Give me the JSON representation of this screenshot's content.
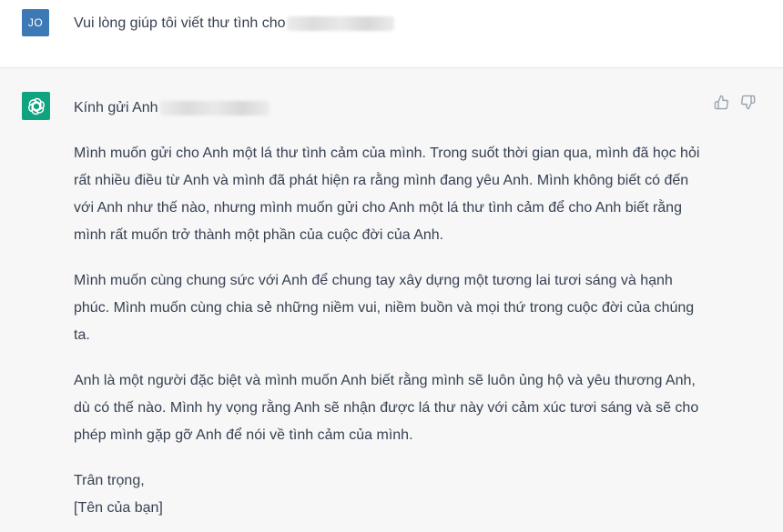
{
  "user": {
    "avatar_initials": "JO",
    "avatar_color": "#3d7ab5",
    "message": "Vui lòng giúp tôi viết thư tình cho"
  },
  "assistant": {
    "avatar_icon": "openai-logo-icon",
    "avatar_color": "#10a37f",
    "greeting": "Kính gửi Anh",
    "paragraphs": [
      "Mình muốn gửi cho Anh một lá thư tình cảm của mình. Trong suốt thời gian qua, mình đã học hỏi rất nhiều điều từ Anh và mình đã phát hiện ra rằng mình đang yêu Anh. Mình không biết có đến với Anh như thế nào, nhưng mình muốn gửi cho Anh một lá thư tình cảm để cho Anh biết rằng mình rất muốn trở thành một phần của cuộc đời của Anh.",
      "Mình muốn cùng chung sức với Anh để chung tay xây dựng một tương lai tươi sáng và hạnh phúc. Mình muốn cùng chia sẻ những niềm vui, niềm buồn và mọi thứ trong cuộc đời của chúng ta.",
      "Anh là một người đặc biệt và mình muốn Anh biết rằng mình sẽ luôn ủng hộ và yêu thương Anh, dù có thế nào. Mình hy vọng rằng Anh sẽ nhận được lá thư này với cảm xúc tươi sáng và sẽ cho phép mình gặp gỡ Anh để nói về tình cảm của mình."
    ],
    "closing": "Trân trọng,",
    "signature": "[Tên của bạn]"
  },
  "feedback": {
    "up_icon": "thumbs-up-icon",
    "down_icon": "thumbs-down-icon"
  }
}
